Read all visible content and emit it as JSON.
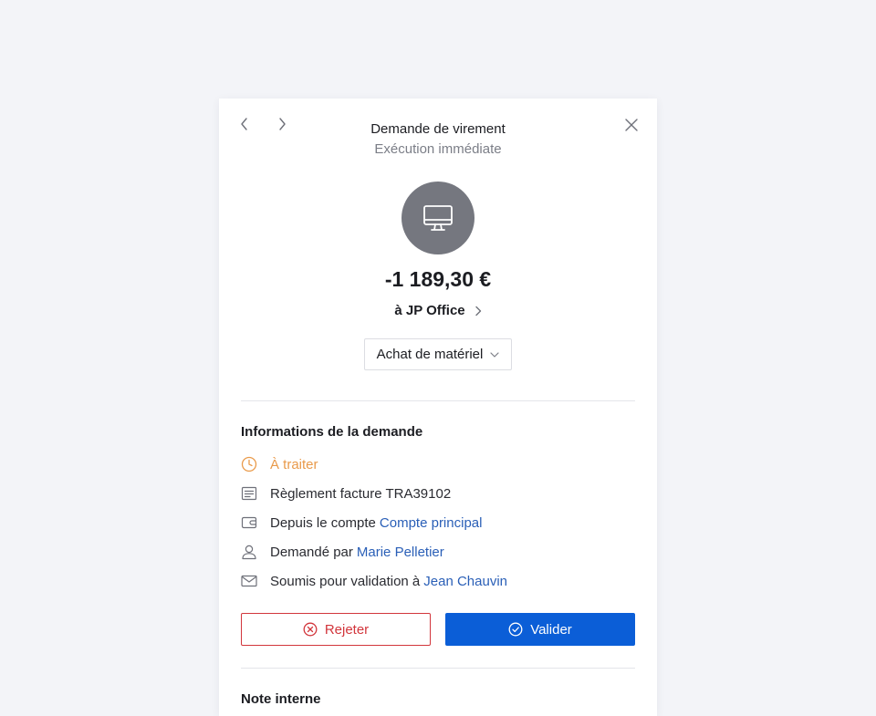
{
  "header": {
    "title": "Demande de virement",
    "subtitle": "Exécution immédiate"
  },
  "transaction": {
    "amount": "-1 189,30 €",
    "recipient": "à JP Office",
    "category": "Achat de matériel",
    "avatar_icon": "monitor-icon"
  },
  "info": {
    "section_title": "Informations de la demande",
    "status": "À traiter",
    "invoice": "Règlement facture TRA39102",
    "account_prefix": "Depuis le compte",
    "account_link": "Compte principal",
    "requester_prefix": "Demandé par",
    "requester_link": "Marie Pelletier",
    "validator_prefix": "Soumis pour validation à",
    "validator_link": "Jean Chauvin"
  },
  "actions": {
    "reject_label": "Rejeter",
    "validate_label": "Valider"
  },
  "note": {
    "section_title": "Note interne"
  },
  "colors": {
    "background": "#f3f4f8",
    "accent": "#0b5ed7",
    "danger": "#d2363c",
    "pending": "#e99a4a",
    "link": "#2a5fb7",
    "avatar": "#75777f"
  }
}
